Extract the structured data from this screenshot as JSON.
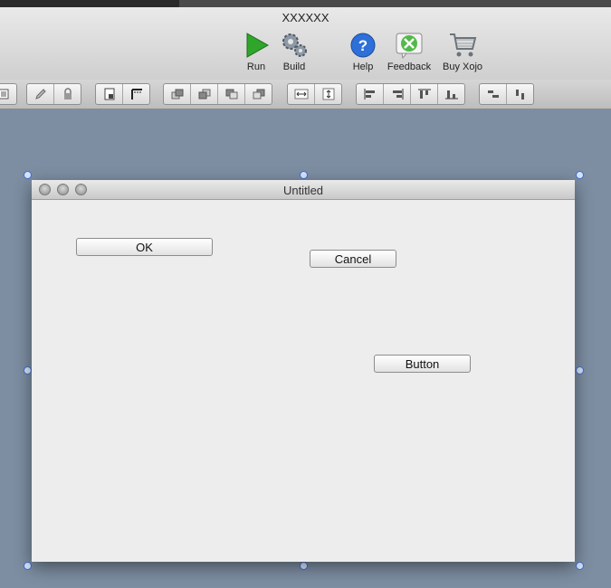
{
  "window": {
    "title": "XXXXXX"
  },
  "toolbar": {
    "items": [
      {
        "label": "Run",
        "icon": "run-icon"
      },
      {
        "label": "Build",
        "icon": "build-icon"
      },
      {
        "label": "Help",
        "icon": "help-icon"
      },
      {
        "label": "Feedback",
        "icon": "feedback-icon"
      },
      {
        "label": "Buy Xojo",
        "icon": "cart-icon"
      }
    ]
  },
  "layout_toolbar": {
    "icons": [
      "list-icon",
      "pencil-icon",
      "lock-icon",
      "tab-order-icon",
      "grid-icon",
      "bring-forward-icon",
      "bring-to-front-icon",
      "send-backward-icon",
      "send-to-back-icon",
      "fill-width-icon",
      "fill-height-icon",
      "align-left-icon",
      "align-right-icon",
      "align-top-icon",
      "align-bottom-icon",
      "distribute-horizontal-icon",
      "distribute-vertical-icon"
    ]
  },
  "design_window": {
    "title": "Untitled",
    "buttons": [
      {
        "label": "OK"
      },
      {
        "label": "Cancel"
      },
      {
        "label": "Button"
      }
    ]
  },
  "colors": {
    "accent": "#3d6fd6",
    "canvas": "#7d8ea2",
    "run_green": "#2fa52b"
  }
}
